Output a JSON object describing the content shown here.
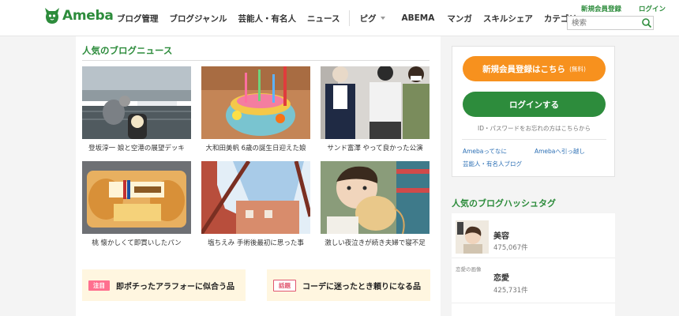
{
  "header": {
    "logo_text": "Ameba",
    "nav": [
      "ブログ管理",
      "ブログジャンル",
      "芸能人・有名人",
      "ニュース"
    ],
    "nav_more": [
      "ピグ",
      "ABEMA",
      "マンガ",
      "スキルシェア",
      "カテゴリ"
    ],
    "register_link": "新規会員登録",
    "login_link": "ログイン",
    "search_placeholder": "検索"
  },
  "news": {
    "title": "人気のブログニュース",
    "items": [
      {
        "caption": "登坂淳一 娘と空港の展望デッキ",
        "image": "airport-deck-photo"
      },
      {
        "caption": "大和田美帆 6歳の誕生日迎えた娘",
        "image": "birthday-cake-photo"
      },
      {
        "caption": "サンド富澤 やって良かった公演",
        "image": "performers-photo"
      },
      {
        "caption": "桃 懐かしくて即買いしたパン",
        "image": "bread-package-photo"
      },
      {
        "caption": "塩ちえみ 手術後最初に思った事",
        "image": "window-sky-photo"
      },
      {
        "caption": "激しい夜泣きが続き夫婦で寝不足",
        "image": "baby-balloon-photo"
      }
    ]
  },
  "promos": [
    {
      "badge": "注目",
      "text": "即ポチったアラフォーに似合う品"
    },
    {
      "badge": "話題",
      "text": "コーデに迷ったとき頼りになる品"
    }
  ],
  "account": {
    "register_button": "新規会員登録はこちら",
    "register_note": "(無料)",
    "login_button": "ログインする",
    "forgot_text": "ID・パスワードをお忘れの方はこちらから",
    "link_about": "Amebaってなに",
    "link_move": "Amebaへ引っ越し",
    "link_celebrity": "芸能人・有名人ブログ"
  },
  "hashtags": {
    "title": "人気のブログハッシュタグ",
    "items": [
      {
        "name": "美容",
        "count": "475,067件",
        "thumb_label": ""
      },
      {
        "name": "恋愛",
        "count": "425,731件",
        "thumb_label": "恋愛の画像"
      }
    ]
  },
  "colors": {
    "brand_green": "#2d8c3c",
    "register_orange": "#f7911e",
    "promo_bg": "#fff6e0",
    "badge_pink": "#ff6f8f"
  }
}
